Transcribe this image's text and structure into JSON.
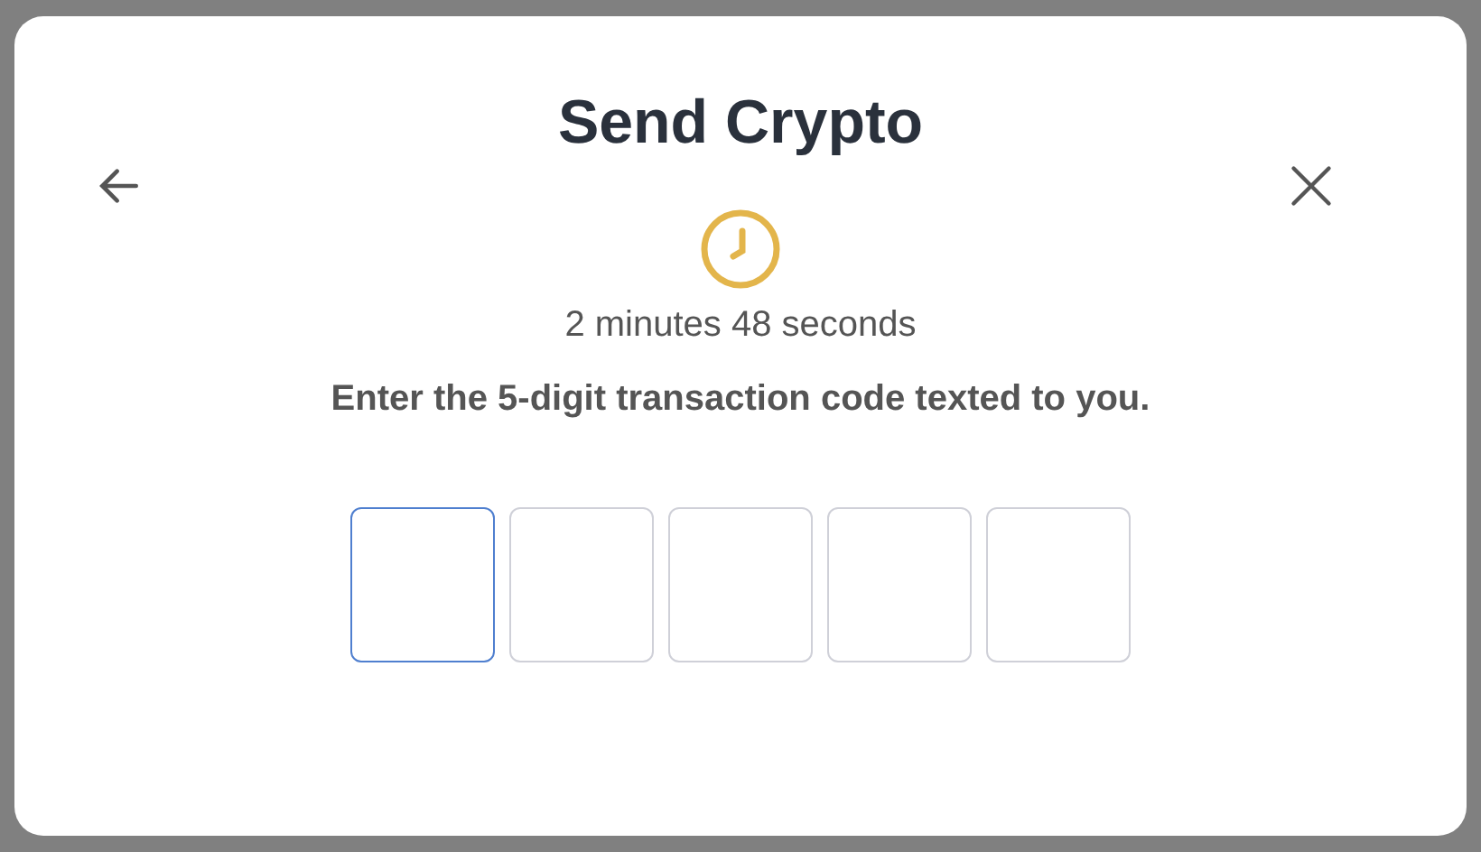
{
  "dialog": {
    "title": "Send Crypto",
    "timer": "2 minutes 48 seconds",
    "instruction": "Enter the 5-digit transaction code texted to you.",
    "code_inputs": [
      {
        "selected": true
      },
      {
        "selected": false
      },
      {
        "selected": false
      },
      {
        "selected": false
      },
      {
        "selected": false
      }
    ]
  }
}
